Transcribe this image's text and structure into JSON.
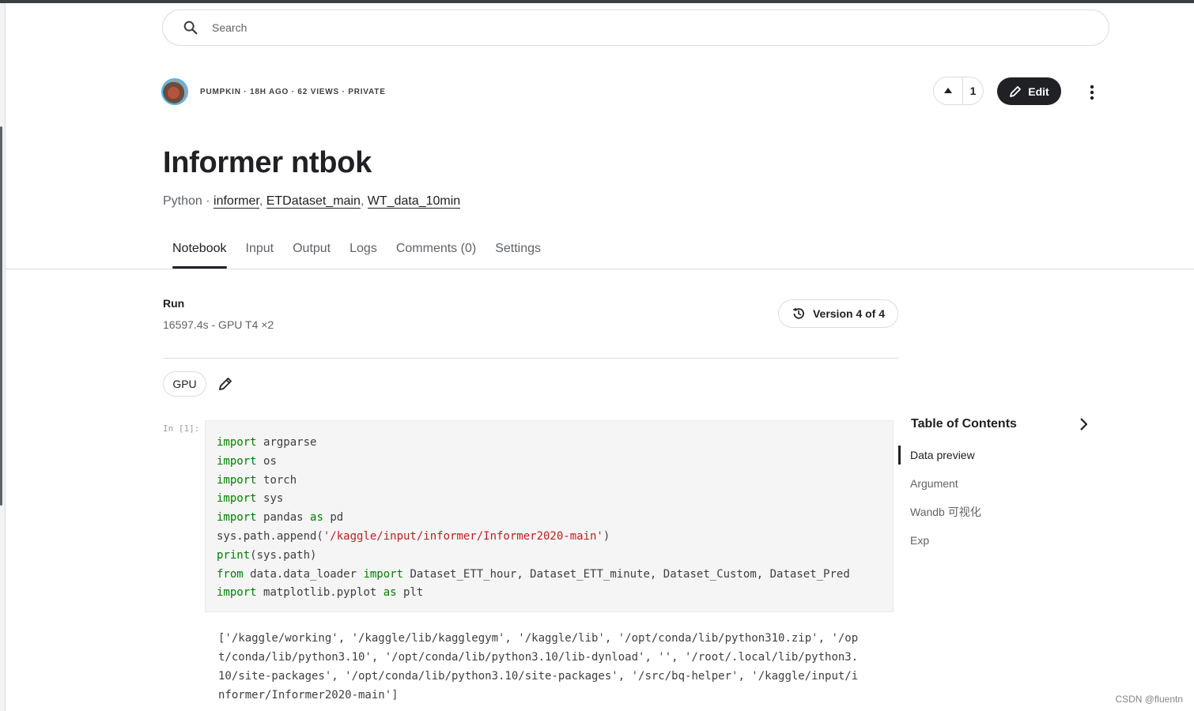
{
  "search": {
    "placeholder": "Search"
  },
  "header": {
    "meta": "PUMPKIN · 18H AGO · 62 VIEWS · PRIVATE",
    "upvote_count": "1",
    "edit_label": "Edit"
  },
  "notebook": {
    "title": "Informer ntbok",
    "language": "Python · ",
    "datasets": [
      "informer",
      "ETDataset_main",
      "WT_data_10min"
    ],
    "sep": ", "
  },
  "tabs": [
    "Notebook",
    "Input",
    "Output",
    "Logs",
    "Comments (0)",
    "Settings"
  ],
  "active_tab": 0,
  "run": {
    "label": "Run",
    "info": "16597.4s - GPU T4 ×2",
    "version_label": "Version 4 of 4"
  },
  "accelerator": "GPU",
  "cell": {
    "prompt": "In [1]:",
    "lines": [
      [
        [
          "kw",
          "import"
        ],
        [
          "",
          "argparse"
        ]
      ],
      [
        [
          "kw",
          "import"
        ],
        [
          "",
          "os"
        ]
      ],
      [
        [
          "kw",
          "import"
        ],
        [
          "",
          "torch"
        ]
      ],
      [
        [
          "kw",
          "import"
        ],
        [
          "",
          "sys"
        ]
      ],
      [
        [
          "kw",
          "import"
        ],
        [
          "",
          "pandas"
        ],
        [
          "kw",
          "as"
        ],
        [
          "",
          "pd"
        ]
      ],
      [
        [
          "",
          "sys.path.append("
        ],
        [
          "str",
          "'/kaggle/input/informer/Informer2020-main'"
        ],
        [
          "",
          ")"
        ]
      ],
      [
        [
          "kw",
          "print"
        ],
        [
          "",
          "(sys.path)"
        ]
      ],
      [
        [
          "kw",
          "from"
        ],
        [
          "",
          "data.data_loader"
        ],
        [
          "kw",
          "import"
        ],
        [
          "",
          "Dataset_ETT_hour, Dataset_ETT_minute, Dataset_Custom, Dataset_Pred"
        ]
      ],
      [
        [
          "kw",
          "import"
        ],
        [
          "",
          "matplotlib.pyplot"
        ],
        [
          "kw",
          "as"
        ],
        [
          "",
          "plt"
        ]
      ]
    ],
    "output_lines": [
      "['/kaggle/working', '/kaggle/lib/kagglegym', '/kaggle/lib', '/opt/conda/lib/python310.zip', '/op",
      "t/conda/lib/python3.10', '/opt/conda/lib/python3.10/lib-dynload', '', '/root/.local/lib/python3.",
      "10/site-packages', '/opt/conda/lib/python3.10/site-packages', '/src/bq-helper', '/kaggle/input/i",
      "nformer/Informer2020-main']"
    ]
  },
  "toc": {
    "title": "Table of Contents",
    "items": [
      "Data preview",
      "Argument",
      "Wandb 可视化",
      "Exp"
    ],
    "active": 0
  },
  "watermark": "CSDN @fluentn"
}
